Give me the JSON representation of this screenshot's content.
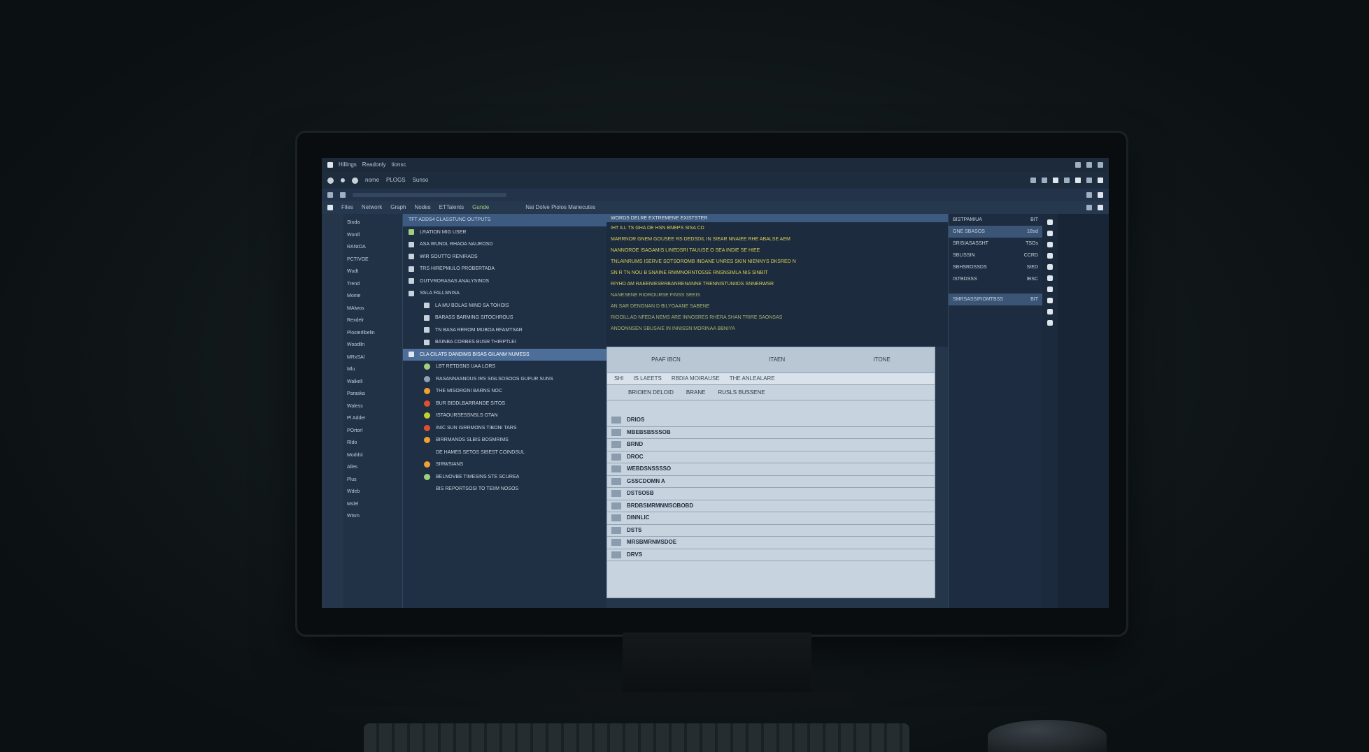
{
  "titlebar": {
    "app": "Hillings",
    "menu1": "Readonly",
    "menu2": "tionsc"
  },
  "toolbar": {
    "item1": "nome",
    "item2": "PLOGS",
    "item3": "Sunso"
  },
  "tabs": [
    "Files",
    "Network",
    "Graph",
    "Nodes",
    "ETTalents",
    "Gunde"
  ],
  "editor_tabs": "Nai Dolve Piolos Manecutes",
  "nav_items": [
    "Stoda",
    "Wordl",
    "RANtOA",
    "PCTIVOE",
    "Wudt",
    "Trend",
    "Monte",
    "MAlwos",
    "Rexdelr",
    "Plosterlibelin",
    "Woodlln",
    "MRxSAl",
    "Mlu",
    "Walkell",
    "Paraska",
    "Waless",
    "Pl Adder",
    "POrtorl",
    "Rldo",
    "Moddsl",
    "Alles",
    "Plus",
    "Wdeb",
    "Mslel",
    "Wtsm"
  ],
  "tree_header": "TFT ADDS4 CLASSTUNC OUTPUTS",
  "tree_rows": [
    {
      "label": "LRATION MIG USER",
      "color": "#9fd07f"
    },
    {
      "label": "ASA WUNDL RHAOA NAUROSD",
      "color": "#c7d2dd"
    },
    {
      "label": "WIR SOUTTO RENIRADS",
      "color": "#c7d2dd"
    },
    {
      "label": "TRS HIREPMULO PROBERTADA",
      "color": "#c7d2dd"
    },
    {
      "label": "OUTVRORASAS ANALYSINDS",
      "color": "#c7d2dd"
    },
    {
      "label": "SSLA FALLSNISA",
      "color": "#c7d2dd"
    },
    {
      "label": "LA MU BOLAS MIND SA TOHOIS",
      "color": "#c7d2dd"
    },
    {
      "label": "BARASS BARMING SITOCHROUS",
      "color": "#c7d2dd"
    },
    {
      "label": "TN BASA REROM MUBOA RFAMTSAR",
      "color": "#c7d2dd"
    },
    {
      "label": "BAINBA CORBES BUSR THIRPTLEI",
      "color": "#c7d2dd"
    }
  ],
  "tree_selected": "CLA CILATS DANDIMS BISAS GILANM NUMESS",
  "tree_children": [
    {
      "label": "LBT RETDSNS UAA LORS",
      "color": "#9fd07f"
    },
    {
      "label": "RASANNASNDUS IRS SISLSOSOOS GUFUR SUNS",
      "color": "#8fa3b6"
    },
    {
      "label": "THE MISORGNI BARNS NOC",
      "color": "#f0a030"
    },
    {
      "label": "BUR BIDDLBARRANDE SITOS",
      "color": "#e05030"
    },
    {
      "label": "ISTAOURSESSNSLS OTAN",
      "color": "#c0d030"
    },
    {
      "label": "INIC SUN ISRRMONS TIBONI TARS",
      "color": "#e05030"
    },
    {
      "label": "BIRRMANDS SLBIS BOSMRIMS",
      "color": "#f0a030"
    },
    {
      "label": "DE HAMES SETOS SIBEST COINDSUL",
      "color": ""
    },
    {
      "label": "SIRWSIANS",
      "color": "#f0a030"
    },
    {
      "label": "BELNOVBE TIMESINS STE SCUREA",
      "color": "#9fd07f"
    },
    {
      "label": "BIS REPORTSOSI TO TEIIM NOSOS",
      "color": ""
    }
  ],
  "editor_header": "WORDS DELRE EXTREMENE EXISTSTER",
  "editor_lines": [
    "IHT ILL TS GHA DE HSN BNEPS SISA CD",
    "MARRNOR GNEM GOUSEE RS DEDSDIL IN SIEAR NNAIEE RHE ABALSE AEM",
    "NANNOROE ISAGAMIS LINEDSRI TAUUSE O SEA INDIE SE HIEE",
    "TNLAINRUMS ISERVE SOTSOROMB INDANE UNRES SKIN NIENNYS DKSRED N",
    "SN R TN NOU B SNAINE RNIMNORNTOSSE RNSNSIMLA NIS SINBIT",
    "RIYHD AM RAEENIESRRBANRENANNE TRENNISTUNIIDS SNNERWSR",
    "NANESENE RIOROURSE FINSS SEEIS",
    "AN SAR DENGNAN D BILYOAANE SABENE",
    "RIOOILLAD NFEDA NEMS ARE INNOSRES RHERA SHAN TRIRE SAONSAS",
    "ANDONNSEN SBUSAIE IN INNISSN MORINAA BBNIYA"
  ],
  "dialog": {
    "col1": "PAAF IBCN",
    "col2": "ITAEN",
    "col3": "ITONE",
    "bar": [
      "SHI",
      "IS LAEETS",
      "RBDIA MOIRAUSE",
      "THE ANLEALARE"
    ],
    "bar2": [
      "BRIOIEN DELOID",
      "BRANE",
      "RUSLS BUSSENE"
    ],
    "items": [
      "DRIOS",
      "MBEBSBSSSOB",
      "BRND",
      "DROC",
      "WEBDSNSSSSO",
      "GSSCDOMN A",
      "DSTSOSB",
      "BRDBSMRMNMSOBOBD",
      "DINNLIC",
      "DSTS",
      "MRSBMRNMSDOE",
      "DRVS"
    ]
  },
  "rpanel": {
    "title": "BISTPAMIUA",
    "title_val": "BIT",
    "rows": [
      {
        "label": "GNE SBASOS",
        "val": "1Bsd"
      },
      {
        "label": "SRISIASASSHT",
        "val": "TSOs"
      },
      {
        "label": "SBLISSIN",
        "val": "CCRD"
      },
      {
        "label": "SBHSROSSDS",
        "val": "SIED"
      },
      {
        "label": "ISTBDSSS",
        "val": "IBSC"
      }
    ],
    "footer": "SMRSASSIFIOMTBSS",
    "footer_val": "BIT"
  },
  "colors": {
    "accent": "#4c6e99",
    "background": "#25364a",
    "code": "#d9cf5a"
  }
}
